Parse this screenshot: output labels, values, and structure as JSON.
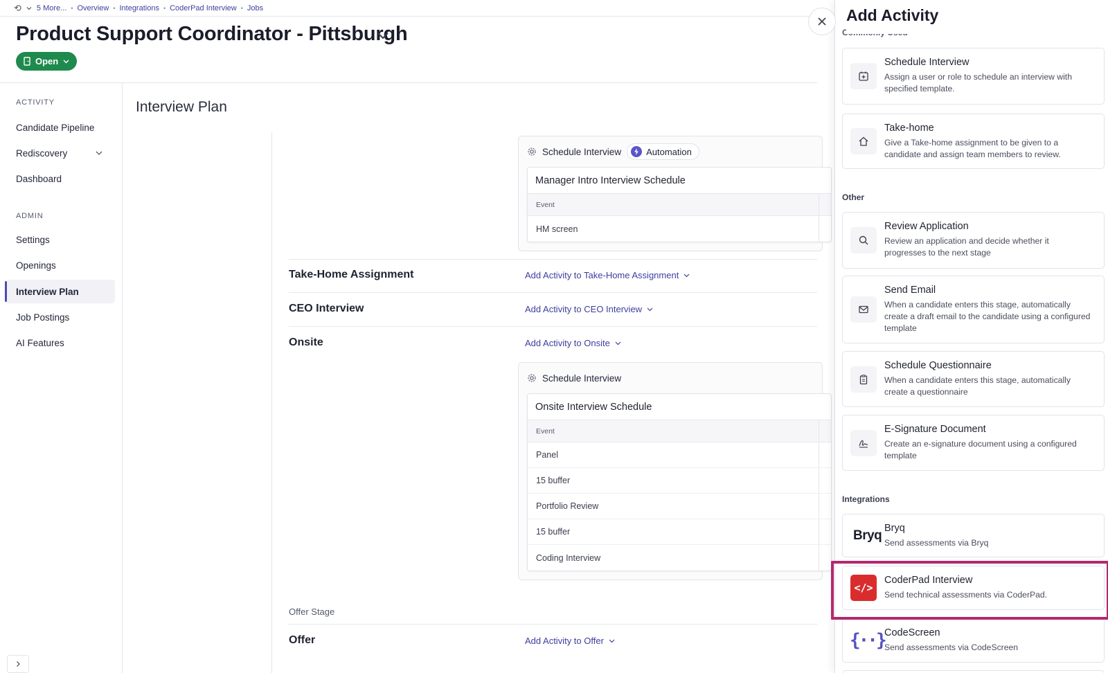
{
  "breadcrumb": {
    "items": [
      "5 More...",
      "Overview",
      "Integrations",
      "CoderPad Interview",
      "Jobs"
    ]
  },
  "header": {
    "title": "Product Support Coordinator - Pittsburgh",
    "status": "Open"
  },
  "sidebar": {
    "activity_label": "ACTIVITY",
    "admin_label": "ADMIN",
    "items": [
      {
        "label": "Candidate Pipeline"
      },
      {
        "label": "Rediscovery"
      },
      {
        "label": "Dashboard"
      },
      {
        "label": "Settings"
      },
      {
        "label": "Openings"
      },
      {
        "label": "Interview Plan"
      },
      {
        "label": "Job Postings"
      },
      {
        "label": "AI Features"
      }
    ]
  },
  "main": {
    "title": "Interview Plan",
    "card1": {
      "type": "Schedule Interview",
      "badge": "Automation",
      "schedule_title": "Manager Intro Interview Schedule",
      "col_event": "Event",
      "rows": [
        "HM screen"
      ]
    },
    "stages": [
      {
        "name": "Take-Home Assignment",
        "add": "Add Activity to Take-Home Assignment"
      },
      {
        "name": "CEO Interview",
        "add": "Add Activity to CEO Interview"
      },
      {
        "name": "Onsite",
        "add": "Add Activity to Onsite"
      },
      {
        "name": "Offer",
        "add": "Add Activity to Offer"
      }
    ],
    "card2": {
      "type": "Schedule Interview",
      "schedule_title": "Onsite Interview Schedule",
      "col_event": "Event",
      "rows": [
        "Panel",
        "15 buffer",
        "Portfolio Review",
        "15 buffer",
        "Coding Interview"
      ]
    },
    "offer_group": "Offer Stage"
  },
  "drawer": {
    "title": "Add Activity",
    "cut_label": "Commonly Used",
    "other_label": "Other",
    "integrations_label": "Integrations",
    "common": [
      {
        "title": "Schedule Interview",
        "desc": "Assign a user or role to schedule an interview with specified template.",
        "icon": "calendar-plus-icon"
      },
      {
        "title": "Take-home",
        "desc": "Give a Take-home assignment to be given to a candidate and assign team members to review.",
        "icon": "house-icon"
      }
    ],
    "other": [
      {
        "title": "Review Application",
        "desc": "Review an application and decide whether it progresses to the next stage",
        "icon": "search-icon"
      },
      {
        "title": "Send Email",
        "desc": "When a candidate enters this stage, automatically create a draft email to the candidate using a configured template",
        "icon": "mail-icon"
      },
      {
        "title": "Schedule Questionnaire",
        "desc": "When a candidate enters this stage, automatically create a questionnaire",
        "icon": "clipboard-icon"
      },
      {
        "title": "E-Signature Document",
        "desc": "Create an e-signature document using a configured template",
        "icon": "signature-icon"
      }
    ],
    "integrations": [
      {
        "title": "Bryq",
        "desc": "Send assessments via Bryq",
        "logo": "Bryq"
      },
      {
        "title": "CoderPad Interview",
        "desc": "Send technical assessments via CoderPad.",
        "logo": "</>"
      },
      {
        "title": "CodeScreen",
        "desc": "Send assessments via CodeScreen",
        "logo": "{··}"
      }
    ]
  },
  "colors": {
    "accent": "#3c3f9e",
    "status_green": "#1f8a4d",
    "highlight": "#b4286e",
    "coderpad_red": "#d92d2d",
    "codescreen_purple": "#5752c4"
  }
}
